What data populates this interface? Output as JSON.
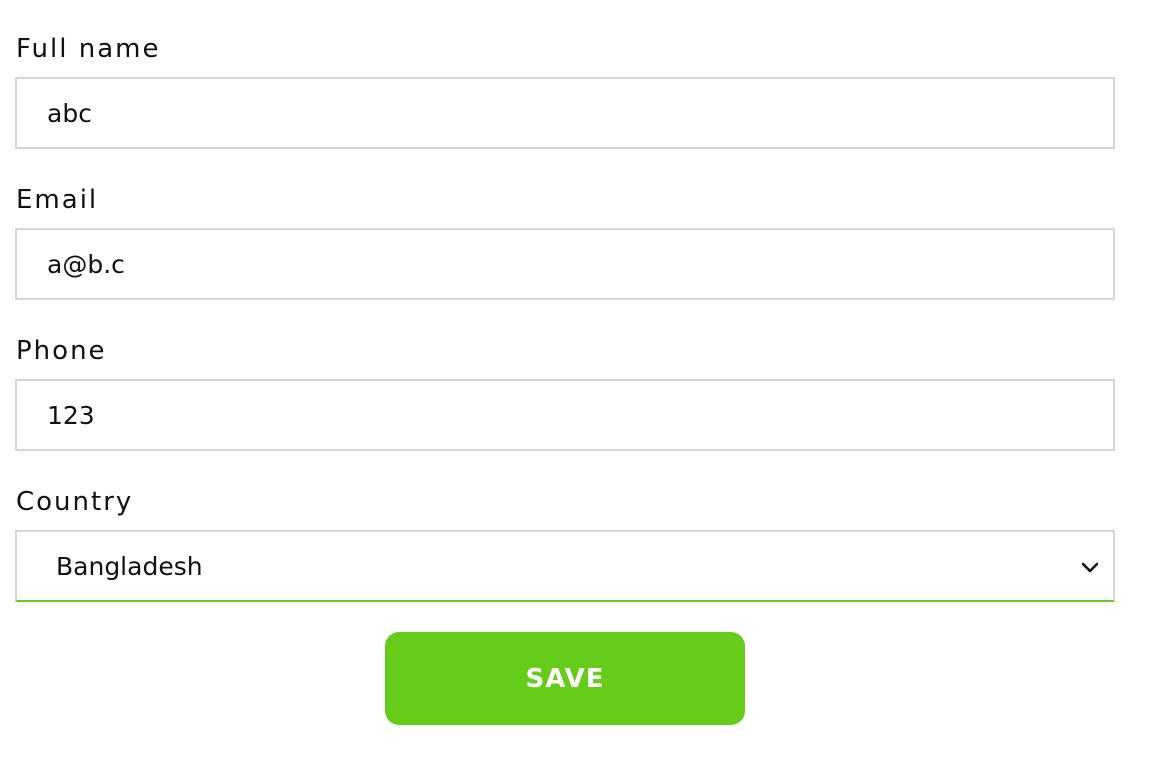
{
  "form": {
    "full_name": {
      "label": "Full name",
      "value": "abc"
    },
    "email": {
      "label": "Email",
      "value": "a@b.c"
    },
    "phone": {
      "label": "Phone",
      "value": "123"
    },
    "country": {
      "label": "Country",
      "selected": "Bangladesh",
      "icon": "chevron-down-icon"
    },
    "save_label": "SAVE"
  },
  "colors": {
    "accent": "#66cc1a",
    "border": "#d6d6d6",
    "text": "#111111",
    "button_text": "#ffffff"
  }
}
